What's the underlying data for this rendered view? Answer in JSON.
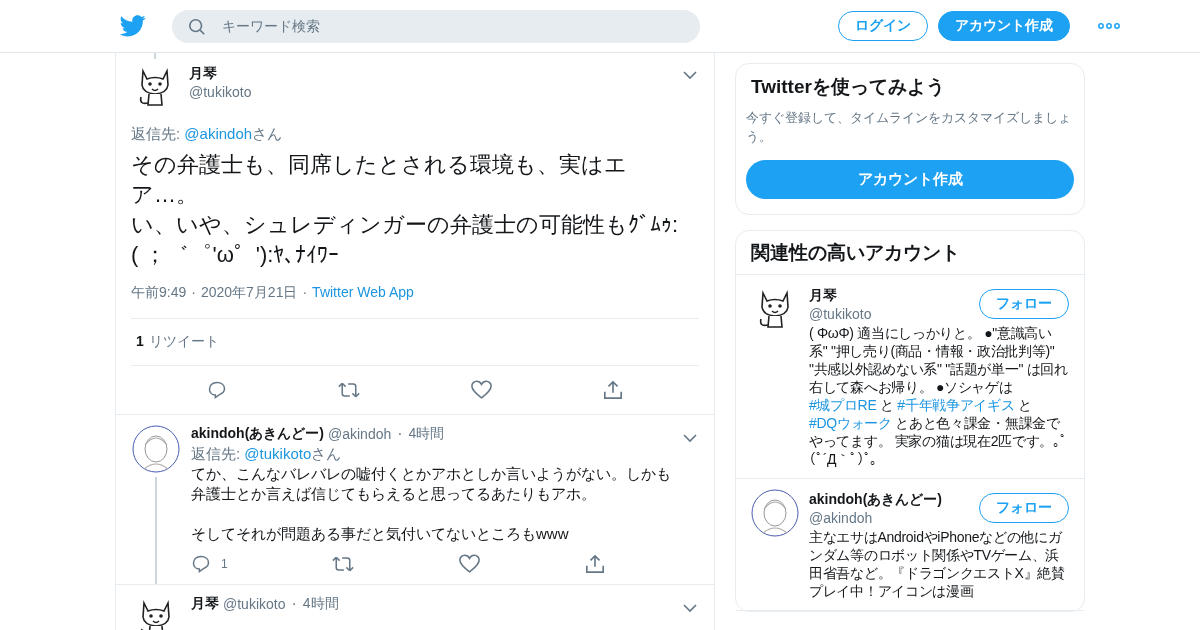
{
  "header": {
    "search": {
      "placeholder": "キーワード検索"
    },
    "login": "ログイン",
    "signup": "アカウント作成"
  },
  "main_tweet": {
    "avatar": {
      "kind": "cat"
    },
    "name": "月琴",
    "handle": "@tukikoto",
    "reply_to": {
      "prefix": "返信先: ",
      "handle": "@akindoh",
      "suffix": "さん"
    },
    "text": [
      "その弁護士も、同席したとされる環境も、実はエア…。",
      "い、いや、シュレディンガーの弁護士の可能性もｸﾞﾑｩ:( ；゛゜'ω゜'):ﾔ､ﾅｲﾜｰ"
    ],
    "meta_separators": [
      "·",
      "·"
    ],
    "time": "午前9:49",
    "date": "2020年7月21日",
    "source": "Twitter Web App",
    "retweet_count": "1",
    "retweet_label": "リツイート"
  },
  "replies": [
    {
      "avatar": {
        "kind": "face"
      },
      "name": "akindoh(あきんどー)",
      "handle": "@akindoh",
      "separator": "·",
      "time": "4時間",
      "thread_line": true,
      "reply_to": {
        "prefix": "返信先: ",
        "handle": "@tukikoto",
        "suffix": "さん"
      },
      "text": [
        "てか、こんなバレバレの嘘付くとかアホとしか言いようがない。しかも弁護士とか言えば信じてもらえると思ってるあたりもアホ。",
        "そしてそれが問題ある事だと気付いてないところもwww"
      ],
      "reply_count": "1"
    },
    {
      "avatar": {
        "kind": "cat"
      },
      "name": "月琴",
      "handle": "@tukikoto",
      "separator": "·",
      "time": "4時間",
      "thread_line": false
    }
  ],
  "sidebar": {
    "signup_card": {
      "title": "Twitterを使ってみよう",
      "description": "今すぐ登録して、タイムラインをカスタマイズしましょう。",
      "button": "アカウント作成"
    },
    "related": {
      "title": "関連性の高いアカウント",
      "accounts": [
        {
          "avatar": {
            "kind": "cat"
          },
          "name": "月琴",
          "handle": "@tukikoto",
          "follow": "フォロー",
          "bio": [
            {
              "kind": "text",
              "text": "( ΦωΦ) 適当にしっかりと。 ●\"意識高い系\" \"押し売り(商品・情報・政治批判等)\" \"共感以外認めない系\" \"話題が単一\" は回れ右して森へお帰り。 ●ソシャゲは "
            },
            {
              "kind": "hashtag",
              "text": "#城プロRE"
            },
            {
              "kind": "text",
              "text": " と "
            },
            {
              "kind": "hashtag",
              "text": "#千年戦争アイギス"
            },
            {
              "kind": "text",
              "text": " と "
            },
            {
              "kind": "hashtag",
              "text": "#DQウォーク"
            },
            {
              "kind": "text",
              "text": " とあと色々課金・無課金でやってます。 実家の猫は現在2匹です。｡ﾟ(ﾟ´Д｀ﾟ)ﾟ｡"
            }
          ]
        },
        {
          "avatar": {
            "kind": "face"
          },
          "name": "akindoh(あきんどー)",
          "handle": "@akindoh",
          "follow": "フォロー",
          "bio": [
            {
              "kind": "text",
              "text": "主なエサはAndroidやiPhoneなどの他にガンダム等のロボット関係やTVゲーム、浜田省吾など。『ドラゴンクエストX』絶賛プレイ中！アイコンは漫画"
            }
          ]
        }
      ]
    }
  }
}
